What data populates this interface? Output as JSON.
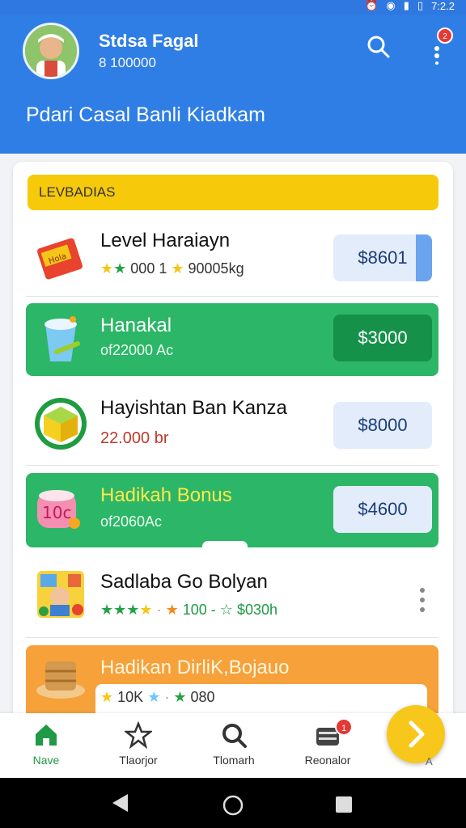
{
  "status": {
    "time": "7:2.2"
  },
  "header": {
    "user_name": "Stdsa Fagal",
    "user_sub": "8 100000",
    "title": "Pdari Casal Banli Kiadkam",
    "notif_count": "2"
  },
  "section": {
    "label": "LEVBADIAS"
  },
  "items": [
    {
      "title": "Level Haraiayn",
      "stars_text": "000 1",
      "sub": "90005kg",
      "price": "$8601"
    },
    {
      "title": "Hanakal",
      "sub": "of22000 Ac",
      "price": "$3000"
    },
    {
      "title": "Hayishtan Ban Kanza",
      "sub": "22.000 br",
      "price": "$8000"
    },
    {
      "title": "Hadikah Bonus",
      "sub": "of2060Ac",
      "price": "$4600",
      "thumb_text": "10c"
    },
    {
      "title": "Sadlaba Go Bolyan",
      "stars_text": "100 -",
      "sub": "$030h"
    },
    {
      "title": "Hadikan DirliK,Bojauo",
      "stars_text": "10K",
      "sub": "080"
    }
  ],
  "bottom_nav": [
    {
      "label": "Nave",
      "icon": "home-icon"
    },
    {
      "label": "Tlaorjor",
      "icon": "star-icon"
    },
    {
      "label": "Tlomarh",
      "icon": "search-icon"
    },
    {
      "label": "Reonalor",
      "icon": "wallet-icon",
      "badge": "1"
    }
  ],
  "fab": {
    "label": "A"
  },
  "colors": {
    "primary": "#2f7ee6",
    "green": "#2cb667",
    "yellow": "#f6c90a",
    "orange": "#f6a13a"
  }
}
